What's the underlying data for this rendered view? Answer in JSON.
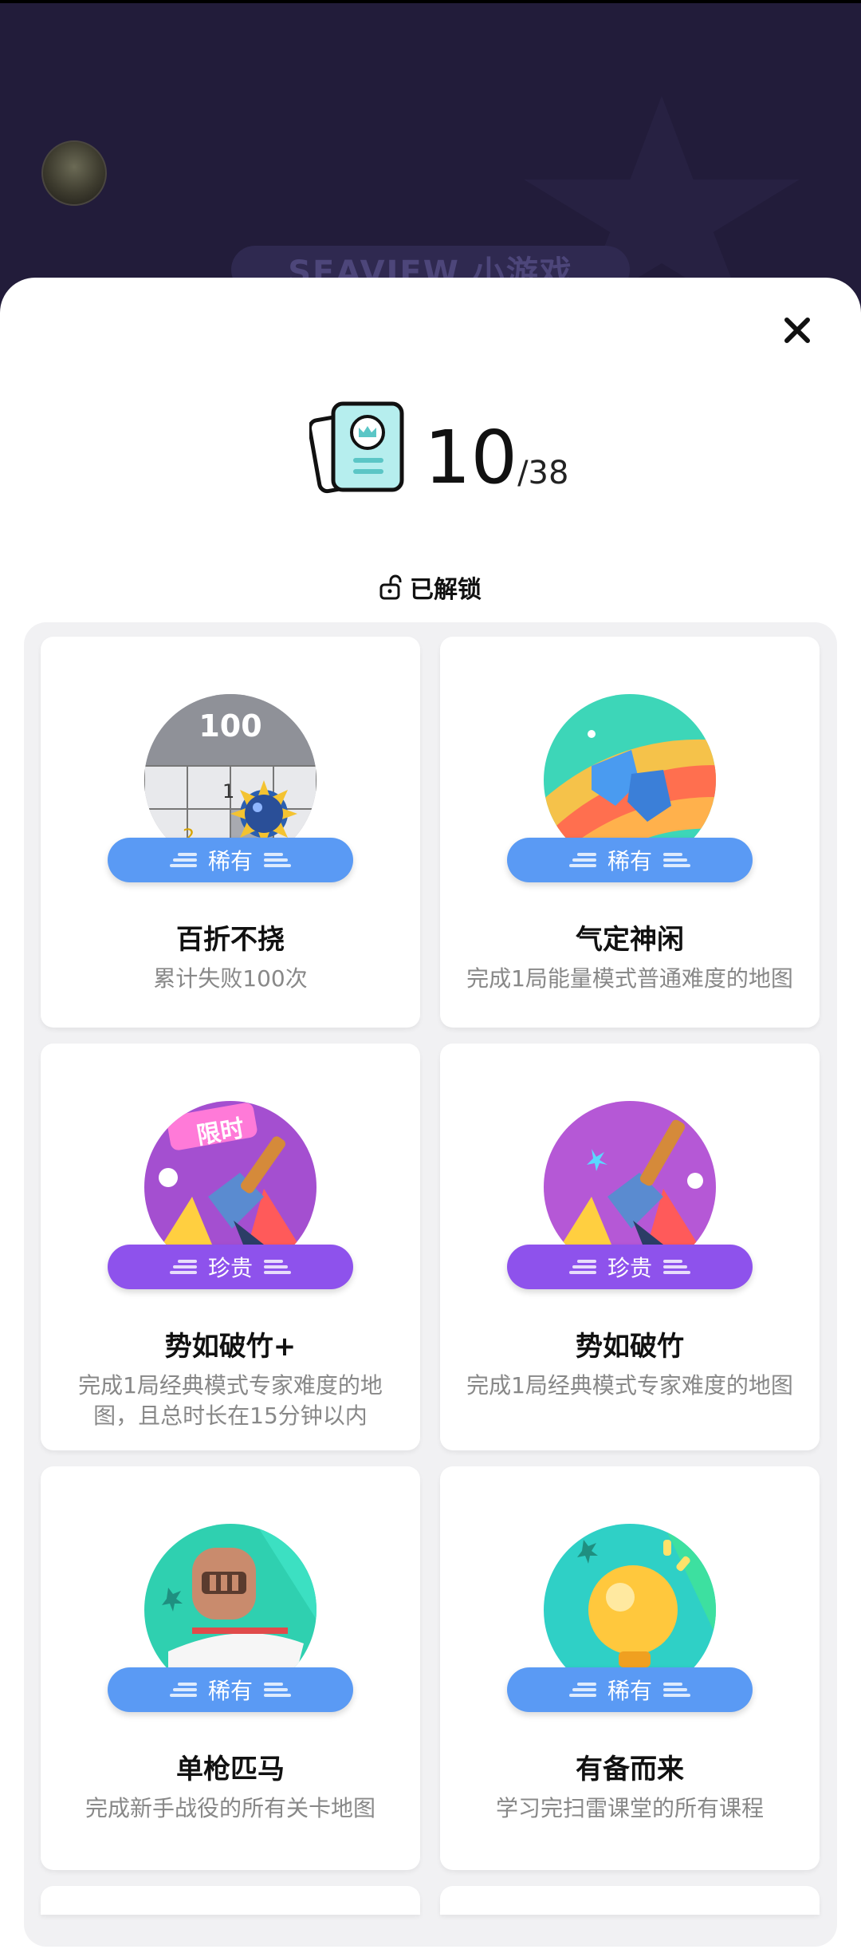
{
  "header": {
    "banner_text": "SEAVIEW 小游戏"
  },
  "dialog": {
    "close_icon": "close-icon",
    "count": "10",
    "total": "/38",
    "unlocked_label": "已解锁"
  },
  "achievements": [
    {
      "title": "百折不挠",
      "desc": "累计失败100次",
      "rarity": "稀有",
      "badge_text": "100",
      "color": "#5a9af4"
    },
    {
      "title": "气定神闲",
      "desc": "完成1局能量模式普通难度的地图",
      "rarity": "稀有",
      "color": "#5a9af4"
    },
    {
      "title": "势如破竹+",
      "desc": "完成1局经典模式专家难度的地图，且总时长在15分钟以内",
      "rarity": "珍贵",
      "badge_text": "限时",
      "color": "#8e52ec"
    },
    {
      "title": "势如破竹",
      "desc": "完成1局经典模式专家难度的地图",
      "rarity": "珍贵",
      "color": "#8e52ec"
    },
    {
      "title": "单枪匹马",
      "desc": "完成新手战役的所有关卡地图",
      "rarity": "稀有",
      "color": "#5a9af4"
    },
    {
      "title": "有备而来",
      "desc": "学习完扫雷课堂的所有课程",
      "rarity": "稀有",
      "color": "#5a9af4"
    }
  ]
}
